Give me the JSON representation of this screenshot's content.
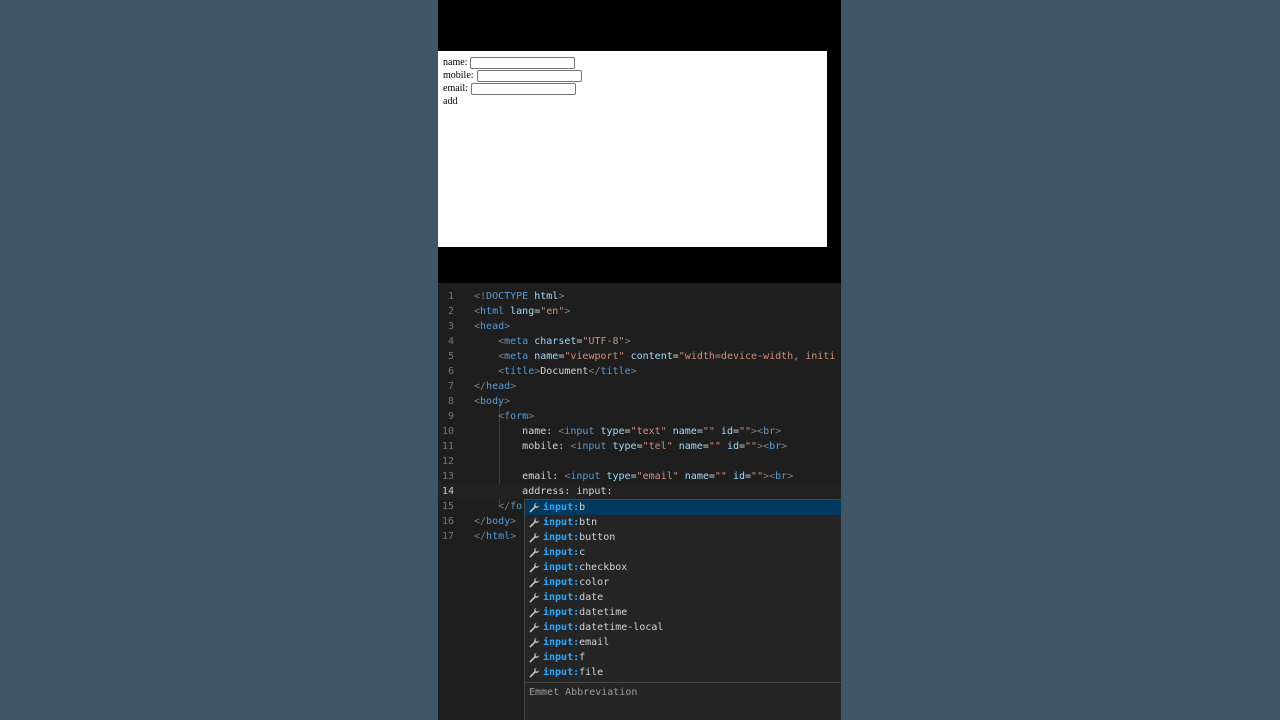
{
  "preview": {
    "fields": [
      {
        "label": "name:"
      },
      {
        "label": "mobile:"
      },
      {
        "label": "email:"
      }
    ],
    "add_text": "add"
  },
  "editor": {
    "lines": [
      {
        "num": "1",
        "indent": "",
        "tokens": [
          [
            "punc",
            "<!"
          ],
          [
            "tag",
            "DOCTYPE "
          ],
          [
            "attr",
            "html"
          ],
          [
            "punc",
            ">"
          ]
        ]
      },
      {
        "num": "2",
        "indent": "",
        "tokens": [
          [
            "punc",
            "<"
          ],
          [
            "tag",
            "html "
          ],
          [
            "attr",
            "lang"
          ],
          [
            "txt",
            "="
          ],
          [
            "str",
            "\"en\""
          ],
          [
            "punc",
            ">"
          ]
        ]
      },
      {
        "num": "3",
        "indent": "",
        "tokens": [
          [
            "punc",
            "<"
          ],
          [
            "tag",
            "head"
          ],
          [
            "punc",
            ">"
          ]
        ]
      },
      {
        "num": "4",
        "indent": "    ",
        "tokens": [
          [
            "punc",
            "<"
          ],
          [
            "tag",
            "meta "
          ],
          [
            "attr",
            "charset"
          ],
          [
            "txt",
            "="
          ],
          [
            "str",
            "\"UTF-8\""
          ],
          [
            "punc",
            ">"
          ]
        ]
      },
      {
        "num": "5",
        "indent": "    ",
        "tokens": [
          [
            "punc",
            "<"
          ],
          [
            "tag",
            "meta "
          ],
          [
            "attr",
            "name"
          ],
          [
            "txt",
            "="
          ],
          [
            "str",
            "\"viewport\" "
          ],
          [
            "attr",
            "content"
          ],
          [
            "txt",
            "="
          ],
          [
            "str",
            "\"width=device-width, initi"
          ]
        ]
      },
      {
        "num": "6",
        "indent": "    ",
        "tokens": [
          [
            "punc",
            "<"
          ],
          [
            "tag",
            "title"
          ],
          [
            "punc",
            ">"
          ],
          [
            "txt",
            "Document"
          ],
          [
            "punc",
            "</"
          ],
          [
            "tag",
            "title"
          ],
          [
            "punc",
            ">"
          ]
        ]
      },
      {
        "num": "7",
        "indent": "",
        "tokens": [
          [
            "punc",
            "</"
          ],
          [
            "tag",
            "head"
          ],
          [
            "punc",
            ">"
          ]
        ]
      },
      {
        "num": "8",
        "indent": "",
        "tokens": [
          [
            "punc",
            "<"
          ],
          [
            "tag",
            "body"
          ],
          [
            "punc",
            ">"
          ]
        ]
      },
      {
        "num": "9",
        "indent": "    ",
        "tokens": [
          [
            "punc",
            "<"
          ],
          [
            "tag",
            "form"
          ],
          [
            "punc",
            ">"
          ]
        ]
      },
      {
        "num": "10",
        "indent": "        ",
        "tokens": [
          [
            "txt",
            "name: "
          ],
          [
            "punc",
            "<"
          ],
          [
            "tag",
            "input "
          ],
          [
            "attr",
            "type"
          ],
          [
            "txt",
            "="
          ],
          [
            "str",
            "\"text\" "
          ],
          [
            "attr",
            "name"
          ],
          [
            "txt",
            "="
          ],
          [
            "str",
            "\"\" "
          ],
          [
            "attr",
            "id"
          ],
          [
            "txt",
            "="
          ],
          [
            "str",
            "\"\""
          ],
          [
            "punc",
            "><"
          ],
          [
            "tag",
            "br"
          ],
          [
            "punc",
            ">"
          ]
        ]
      },
      {
        "num": "11",
        "indent": "        ",
        "tokens": [
          [
            "txt",
            "mobile: "
          ],
          [
            "punc",
            "<"
          ],
          [
            "tag",
            "input "
          ],
          [
            "attr",
            "type"
          ],
          [
            "txt",
            "="
          ],
          [
            "str",
            "\"tel\" "
          ],
          [
            "attr",
            "name"
          ],
          [
            "txt",
            "="
          ],
          [
            "str",
            "\"\" "
          ],
          [
            "attr",
            "id"
          ],
          [
            "txt",
            "="
          ],
          [
            "str",
            "\"\""
          ],
          [
            "punc",
            "><"
          ],
          [
            "tag",
            "br"
          ],
          [
            "punc",
            ">"
          ]
        ]
      },
      {
        "num": "12",
        "indent": "",
        "tokens": []
      },
      {
        "num": "13",
        "indent": "        ",
        "tokens": [
          [
            "txt",
            "email: "
          ],
          [
            "punc",
            "<"
          ],
          [
            "tag",
            "input "
          ],
          [
            "attr",
            "type"
          ],
          [
            "txt",
            "="
          ],
          [
            "str",
            "\"email\" "
          ],
          [
            "attr",
            "name"
          ],
          [
            "txt",
            "="
          ],
          [
            "str",
            "\"\" "
          ],
          [
            "attr",
            "id"
          ],
          [
            "txt",
            "="
          ],
          [
            "str",
            "\"\""
          ],
          [
            "punc",
            "><"
          ],
          [
            "tag",
            "br"
          ],
          [
            "punc",
            ">"
          ]
        ]
      },
      {
        "num": "14",
        "indent": "        ",
        "tokens": [
          [
            "txt",
            "address: input:"
          ]
        ]
      },
      {
        "num": "15",
        "indent": "    ",
        "tokens": [
          [
            "punc",
            "</"
          ],
          [
            "tag",
            "fo"
          ]
        ]
      },
      {
        "num": "16",
        "indent": "",
        "tokens": [
          [
            "punc",
            "</"
          ],
          [
            "tag",
            "body"
          ],
          [
            "punc",
            ">"
          ]
        ]
      },
      {
        "num": "17",
        "indent": "",
        "tokens": [
          [
            "punc",
            "</"
          ],
          [
            "tag",
            "html"
          ],
          [
            "punc",
            ">"
          ]
        ]
      }
    ]
  },
  "suggest": {
    "match_prefix": "input:",
    "items": [
      {
        "rest": "b",
        "selected": true
      },
      {
        "rest": "btn"
      },
      {
        "rest": "button"
      },
      {
        "rest": "c"
      },
      {
        "rest": "checkbox"
      },
      {
        "rest": "color"
      },
      {
        "rest": "date"
      },
      {
        "rest": "datetime"
      },
      {
        "rest": "datetime-local"
      },
      {
        "rest": "email"
      },
      {
        "rest": "f"
      },
      {
        "rest": "file"
      }
    ],
    "icon": "wrench-icon",
    "detail_title": "Emmet Abbreviation"
  },
  "colors": {
    "background": "#3f5668",
    "editor_bg": "#1e1e1e",
    "suggest_bg": "#252526",
    "selected_bg": "#04395e",
    "match": "#2aaaff"
  }
}
